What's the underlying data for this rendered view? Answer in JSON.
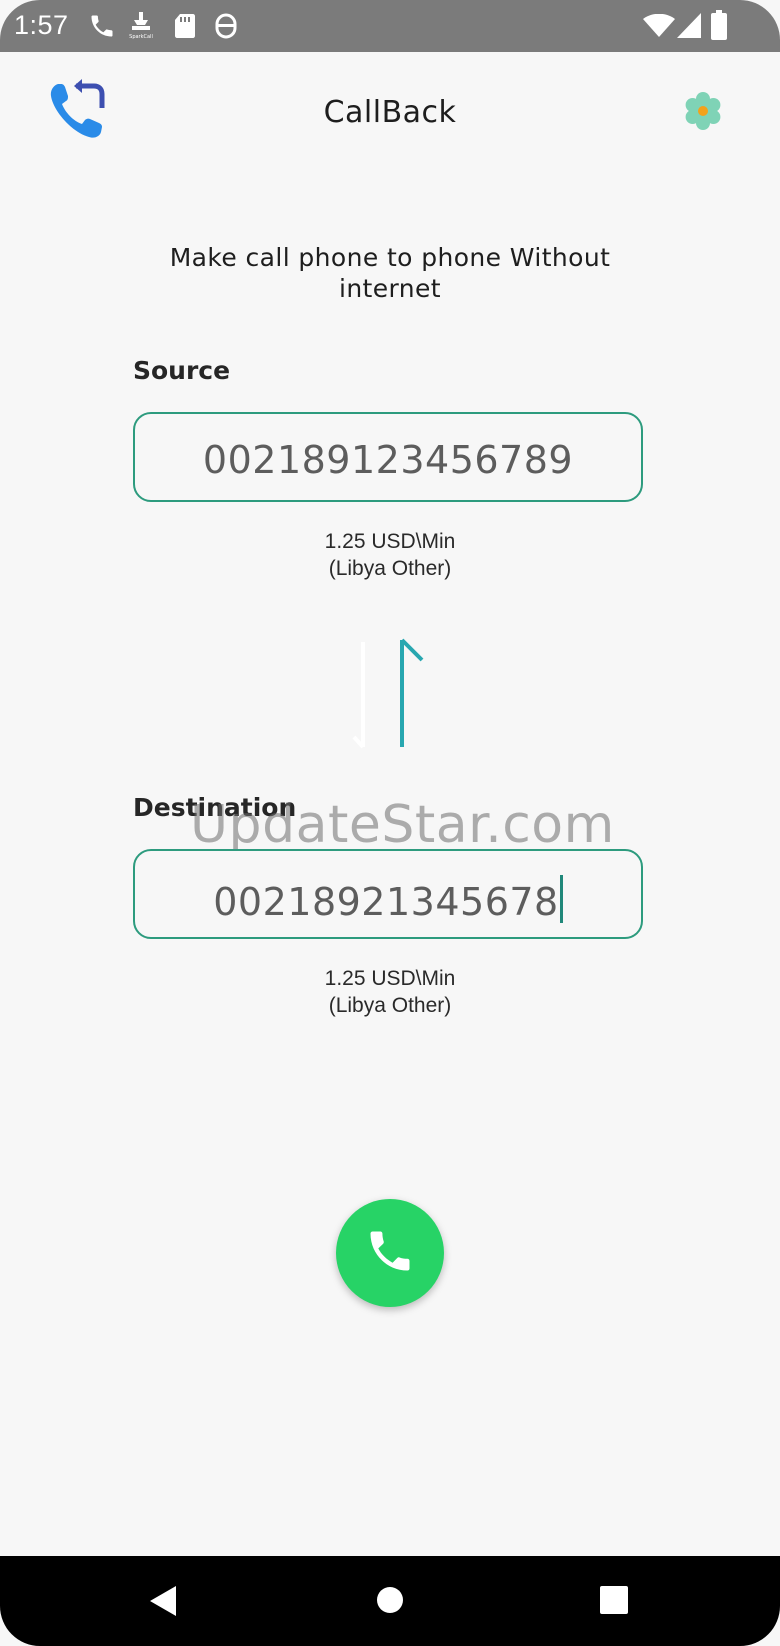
{
  "status_bar": {
    "time": "1:57",
    "icons_left": [
      "phone-icon",
      "sparkcall-icon",
      "sd-card-icon",
      "notification-icon"
    ],
    "icons_right": [
      "wifi-icon",
      "signal-icon",
      "battery-icon"
    ]
  },
  "app_bar": {
    "title": "CallBack",
    "logo_icon": "callback-logo-icon",
    "settings_icon": "settings-flower-icon"
  },
  "tagline": "Make call phone to phone Without internet",
  "source": {
    "label": "Source",
    "value": "002189123456789",
    "rate": "1.25 USD\\Min",
    "country": "(Libya Other)"
  },
  "swap_icon": "swap-arrows-icon",
  "watermark": "UpdateStar.com",
  "destination": {
    "label": "Destination",
    "value": "00218921345678",
    "rate": "1.25 USD\\Min",
    "country": "(Libya Other)"
  },
  "call_button_icon": "phone-handset-icon",
  "nav_bar": {
    "buttons": [
      "back-icon",
      "home-icon",
      "recents-icon"
    ]
  },
  "colors": {
    "accent": "#2d9b7e",
    "call_green": "#27d366",
    "logo_blue": "#2a8be8",
    "status_bar": "#7b7b7b"
  }
}
